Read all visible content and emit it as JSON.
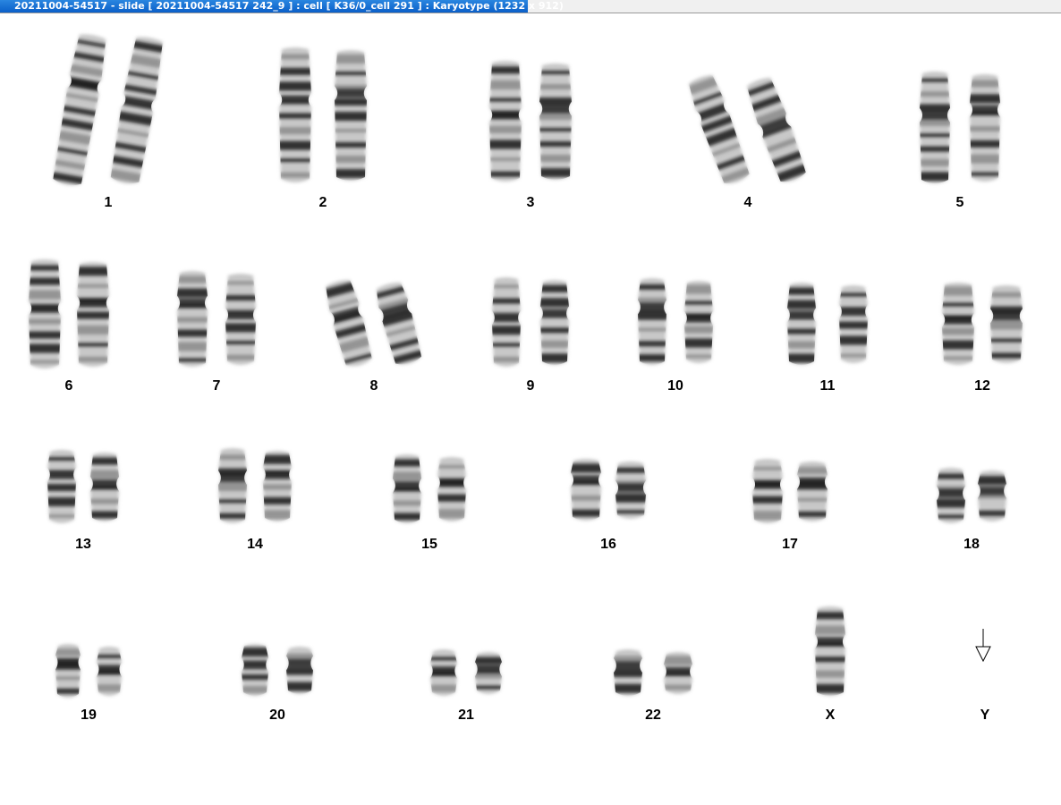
{
  "window": {
    "title": "20211004-54517 - slide [ 20211004-54517 242_9 ] : cell [ K36/0_cell 291 ] : Karyotype  (1232 x 912)"
  },
  "colors": {
    "title_active": "#0a5fc8",
    "title_text": "#ffffff",
    "background": "#ffffff",
    "chromosome_dark": "#1a1a1a",
    "chromosome_light": "#c8c8c8"
  },
  "karyotype": {
    "pairs": [
      {
        "label": "1",
        "count": 2
      },
      {
        "label": "2",
        "count": 2
      },
      {
        "label": "3",
        "count": 2
      },
      {
        "label": "4",
        "count": 2
      },
      {
        "label": "5",
        "count": 2
      },
      {
        "label": "6",
        "count": 2
      },
      {
        "label": "7",
        "count": 2
      },
      {
        "label": "8",
        "count": 2
      },
      {
        "label": "9",
        "count": 2
      },
      {
        "label": "10",
        "count": 2
      },
      {
        "label": "11",
        "count": 2
      },
      {
        "label": "12",
        "count": 2
      },
      {
        "label": "13",
        "count": 2
      },
      {
        "label": "14",
        "count": 2
      },
      {
        "label": "15",
        "count": 2
      },
      {
        "label": "16",
        "count": 2
      },
      {
        "label": "17",
        "count": 2
      },
      {
        "label": "18",
        "count": 2
      },
      {
        "label": "19",
        "count": 2
      },
      {
        "label": "20",
        "count": 2
      },
      {
        "label": "21",
        "count": 2
      },
      {
        "label": "22",
        "count": 2
      },
      {
        "label": "X",
        "count": 1
      },
      {
        "label": "Y",
        "count": 0,
        "icon": "arrow-down-icon"
      }
    ]
  }
}
